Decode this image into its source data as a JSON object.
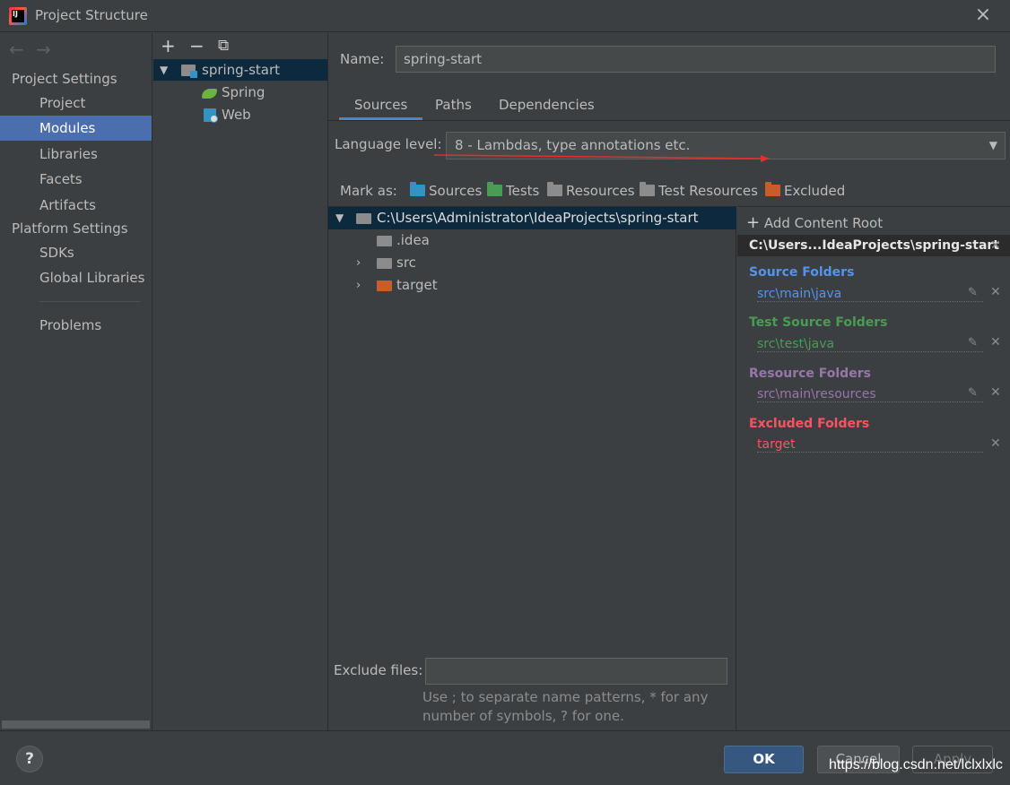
{
  "window": {
    "title": "Project Structure",
    "close_icon": "×"
  },
  "nav": {
    "project_settings_header": "Project Settings",
    "project_items": [
      "Project",
      "Modules",
      "Libraries",
      "Facets",
      "Artifacts"
    ],
    "platform_settings_header": "Platform Settings",
    "platform_items": [
      "SDKs",
      "Global Libraries"
    ],
    "problems": "Problems",
    "selected": "Modules"
  },
  "modules": {
    "toolbar": {
      "add": "+",
      "remove": "−",
      "copy": "⧉"
    },
    "root": "spring-start",
    "children": [
      "Spring",
      "Web"
    ]
  },
  "main": {
    "name_label": "Name:",
    "name_value": "spring-start",
    "tabs": [
      "Sources",
      "Paths",
      "Dependencies"
    ],
    "active_tab": "Sources",
    "language_level_label": "Language level:",
    "language_level_value": "8 - Lambdas, type annotations etc.",
    "mark_as_label": "Mark as:",
    "mark_as": [
      {
        "label": "Sources",
        "color": "#3592c4"
      },
      {
        "label": "Tests",
        "color": "#499c54"
      },
      {
        "label": "Resources",
        "color": "#8c8c8c"
      },
      {
        "label": "Test Resources",
        "color": "#8c8c8c"
      },
      {
        "label": "Excluded",
        "color": "#c75d2d"
      }
    ]
  },
  "tree": {
    "root": "C:\\Users\\Administrator\\IdeaProjects\\spring-start",
    "items": [
      {
        "label": ".idea",
        "color": "#8c8c8c"
      },
      {
        "label": "src",
        "color": "#8c8c8c"
      },
      {
        "label": "target",
        "color": "#c75d2d"
      }
    ]
  },
  "content_root": {
    "add_label": "Add Content Root",
    "header": "C:\\Users...IdeaProjects\\spring-start",
    "sections": [
      {
        "title": "Source Folders",
        "path": "src\\main\\java",
        "color": "#5394ec",
        "path_color": "#5394ec"
      },
      {
        "title": "Test Source Folders",
        "path": "src\\test\\java",
        "color": "#499c54",
        "path_color": "#499c54"
      },
      {
        "title": "Resource Folders",
        "path": "src\\main\\resources",
        "color": "#9876aa",
        "path_color": "#9876aa"
      },
      {
        "title": "Excluded Folders",
        "path": "target",
        "color": "#ff5261",
        "path_color": "#ff5261"
      }
    ]
  },
  "exclude": {
    "label": "Exclude files:",
    "value": "",
    "hint_line1": "Use ; to separate name patterns, * for any",
    "hint_line2": "number of symbols, ? for one."
  },
  "footer": {
    "help": "?",
    "ok": "OK",
    "cancel": "Cancel",
    "apply": "Apply",
    "watermark": "https://blog.csdn.net/lclxlxlc"
  }
}
